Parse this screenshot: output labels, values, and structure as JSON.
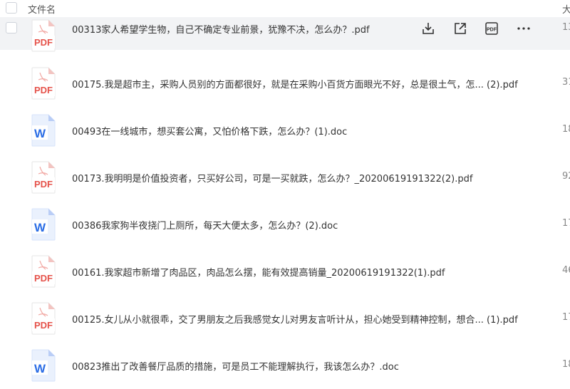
{
  "header": {
    "name_label": "文件名",
    "size_label": "大"
  },
  "files": [
    {
      "type": "pdf",
      "name": "00313家人希望学生物，自己不确定专业前景，犹豫不决，怎么办？.pdf",
      "size": "13"
    },
    {
      "type": "pdf",
      "name": "00175.我是超市主，采购人员别的方面都很好，就是在采购小百货方面眼光不好，总是很土气，怎... (2).pdf",
      "size": "31"
    },
    {
      "type": "doc",
      "name": "00493在一线城市，想买套公寓，又怕价格下跌，怎么办？(1).doc",
      "size": "18"
    },
    {
      "type": "pdf",
      "name": "00173.我明明是价值投资者，只买好公司，可是一买就跌，怎么办？_20200619191322(2).pdf",
      "size": "92"
    },
    {
      "type": "doc",
      "name": "00386我家狗半夜挠门上厕所，每天大便太多，怎么办？(2).doc",
      "size": "17"
    },
    {
      "type": "pdf",
      "name": "00161.我家超市新增了肉品区，肉品怎么摆，能有效提高销量_20200619191322(1).pdf",
      "size": "46"
    },
    {
      "type": "pdf",
      "name": "00125.女儿从小就很乖，交了男朋友之后我感觉女儿对男友言听计从，担心她受到精神控制，想合... (1).pdf",
      "size": "17"
    },
    {
      "type": "doc",
      "name": "00823推出了改善餐厅品质的措施，可是员工不能理解执行，我该怎么办？.doc",
      "size": "18"
    }
  ],
  "icons": {
    "pdf_label": "PDF",
    "doc_label": "W",
    "pdf_color": "#e5534b",
    "doc_color": "#2b6de5"
  },
  "hover_actions": [
    "download-icon",
    "share-icon",
    "pdf-convert-icon",
    "more-icon"
  ]
}
